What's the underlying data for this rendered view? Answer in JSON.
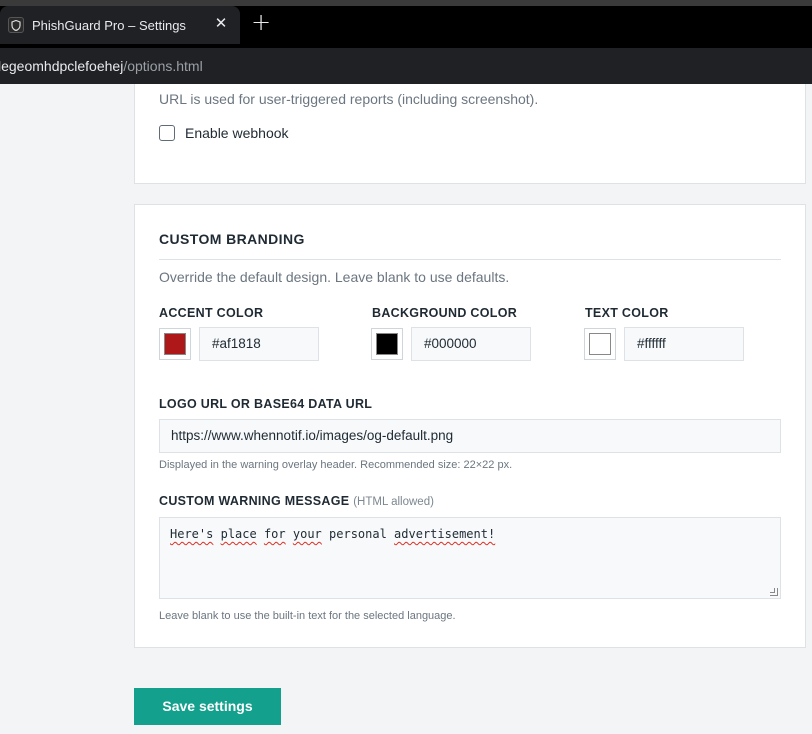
{
  "browser": {
    "tab_title": "PhishGuard Pro – Settings",
    "tab_close": "✕",
    "new_tab": "+",
    "url_host": "legeomhdpclefoehej",
    "url_path": "/options.html"
  },
  "webhook": {
    "description": "URL is used for user-triggered reports (including screenshot).",
    "enable_label": "Enable webhook",
    "enabled": false
  },
  "branding": {
    "title": "CUSTOM BRANDING",
    "description": "Override the default design. Leave blank to use defaults.",
    "accent": {
      "label": "ACCENT COLOR",
      "value": "#af1818",
      "swatch": "#af1818"
    },
    "background": {
      "label": "BACKGROUND COLOR",
      "value": "#000000",
      "swatch": "#000000"
    },
    "text": {
      "label": "TEXT COLOR",
      "value": "#ffffff",
      "swatch": "#ffffff"
    },
    "logo": {
      "label": "LOGO URL OR BASE64 DATA URL",
      "value": "https://www.whennotif.io/images/og-default.png",
      "hint": "Displayed in the warning overlay header. Recommended size: 22×22 px."
    },
    "warning": {
      "label": "CUSTOM WARNING MESSAGE",
      "label_suffix": "(HTML allowed)",
      "words": [
        "Here's",
        "place",
        "for",
        "your",
        "personal",
        "advertisement!"
      ],
      "hint": "Leave blank to use the built-in text for the selected language."
    }
  },
  "actions": {
    "save_label": "Save settings"
  },
  "colors": {
    "brand": "#13a08c"
  }
}
